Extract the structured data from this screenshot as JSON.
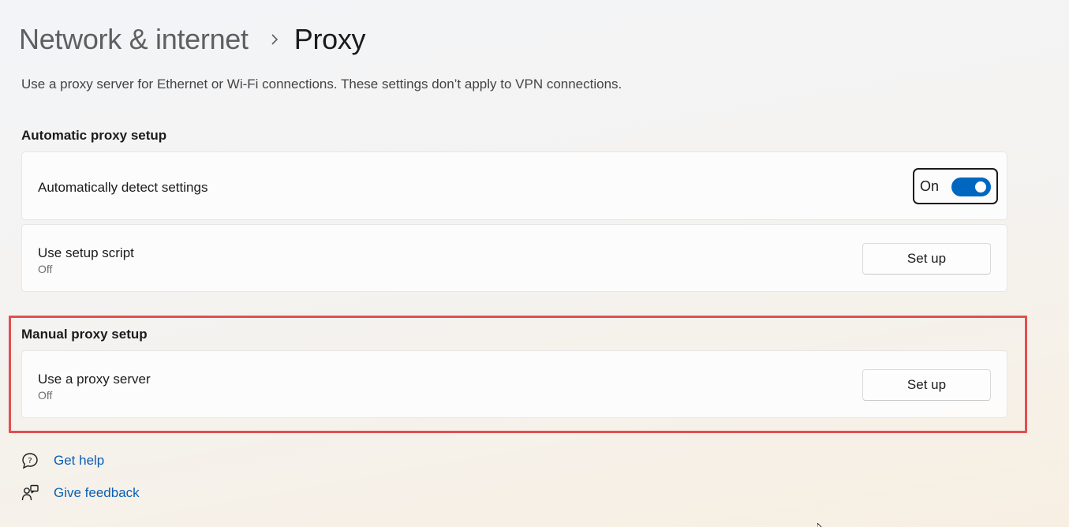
{
  "breadcrumb": {
    "parent": "Network & internet",
    "separator_icon": "chevron-right-icon",
    "current": "Proxy"
  },
  "description": "Use a proxy server for Ethernet or Wi-Fi connections. These settings don’t apply to VPN connections.",
  "automatic": {
    "title": "Automatic proxy setup",
    "detect": {
      "label": "Automatically detect settings",
      "toggle_state": "On",
      "toggle_on": true
    },
    "script": {
      "label": "Use setup script",
      "status": "Off",
      "button": "Set up"
    }
  },
  "manual": {
    "title": "Manual proxy setup",
    "proxy_server": {
      "label": "Use a proxy server",
      "status": "Off",
      "button": "Set up"
    }
  },
  "links": [
    {
      "label": "Get help",
      "icon": "help-chat-icon"
    },
    {
      "label": "Give feedback",
      "icon": "feedback-icon"
    }
  ],
  "colors": {
    "accent": "#0067c0",
    "link": "#0a5fb3",
    "highlight_border": "#e05050"
  }
}
